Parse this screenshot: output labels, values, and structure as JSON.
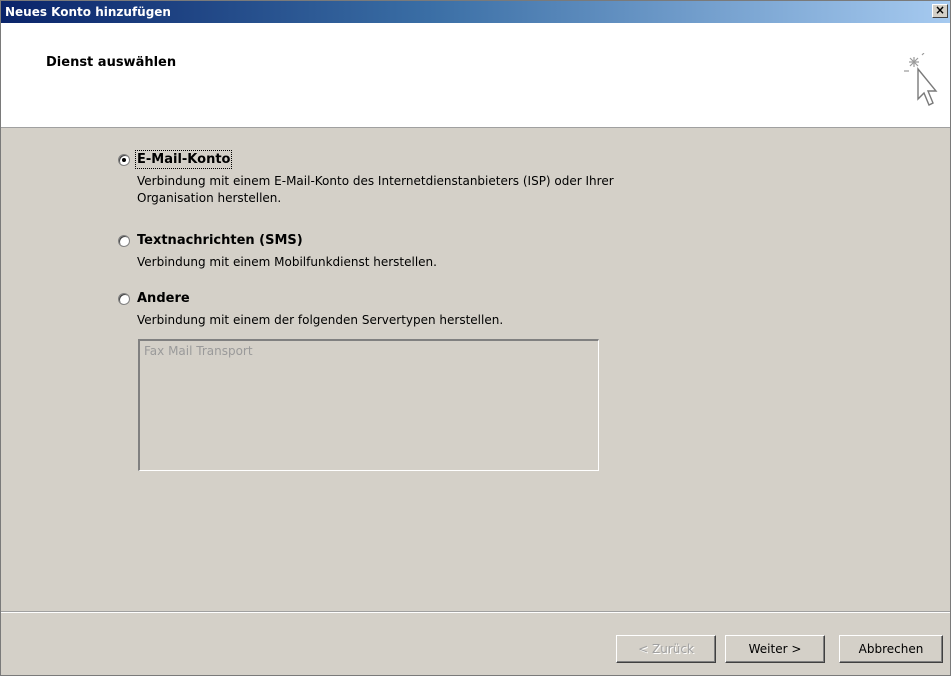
{
  "window": {
    "title": "Neues Konto hinzufügen",
    "close_glyph": "×"
  },
  "header": {
    "title": "Dienst auswählen",
    "icon": "wizard-sparkle-cursor-icon"
  },
  "options": [
    {
      "label": "E-Mail-Konto",
      "checked": true,
      "description_lines": [
        "Verbindung mit einem E-Mail-Konto des Internetdienstanbieters (ISP) oder Ihrer",
        "Organisation herstellen."
      ]
    },
    {
      "label": "Textnachrichten (SMS)",
      "checked": false,
      "description_lines": [
        "Verbindung mit einem Mobilfunkdienst herstellen."
      ]
    },
    {
      "label": "Andere",
      "checked": false,
      "description_lines": [
        "Verbindung mit einem der folgenden Servertypen herstellen."
      ]
    }
  ],
  "server_list": {
    "items": [
      "Fax Mail Transport"
    ],
    "enabled": false
  },
  "buttons": {
    "back": "< Zurück",
    "next": "Weiter >",
    "cancel": "Abbrechen"
  }
}
